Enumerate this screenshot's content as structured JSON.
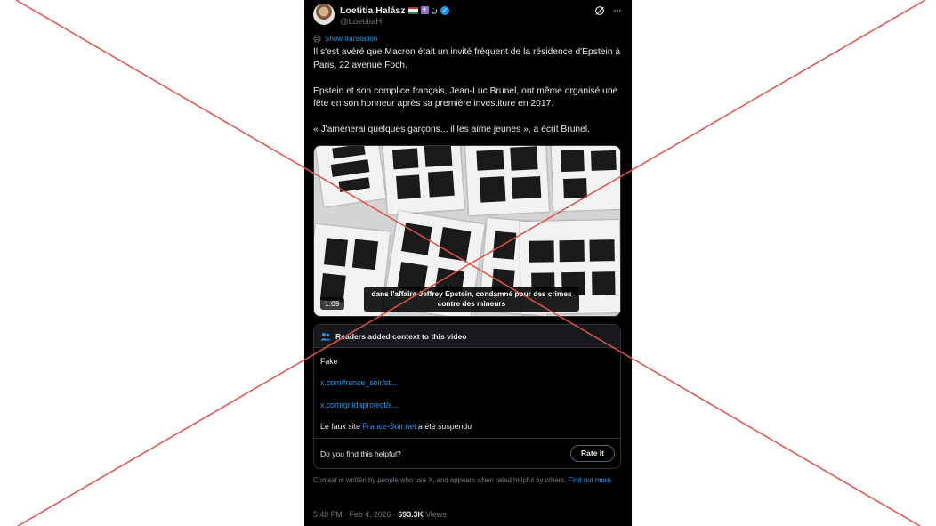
{
  "author": {
    "display_name": "Loetitia Halász",
    "arabic_glyph": "ن",
    "handle": "@LoetitiaH"
  },
  "icons": {
    "avatar": "avatar-photo",
    "flag": "hungarian-flag-icon",
    "religious": "latin-cross-icon",
    "verified": "verified-badge-icon",
    "grok": "grok-icon",
    "more": "more-icon",
    "translate": "globe-icon",
    "community": "people-icon"
  },
  "translate_label": "Show translation",
  "tweet": {
    "paragraph1": "Il s'est avéré que Macron était un invité fréquent de la résidence d'Epstein à Paris, 22 avenue Foch.",
    "paragraph2": "Epstein et son complice français, Jean-Luc Brunel, ont même organisé une fête en son honneur après sa première investiture en 2017.",
    "paragraph3": "« J'amènerai quelques garçons... il les aime jeunes », a écrit Brunel."
  },
  "video": {
    "duration": "1:09",
    "subtitle": "dans l'affaire Jeffrey Epstein, condamné pour des crimes contre des mineurs"
  },
  "community_note": {
    "title": "Readers added context to this video",
    "line1": "Fake",
    "link1": "x.com/france_soir/st...",
    "link2": "x.com/gnidaproject/s...",
    "line4_prefix": "Le faux site ",
    "line4_link": "France-Soir.net",
    "line4_suffix": " a été suspendu",
    "helpful_question": "Do you find this helpful?",
    "rate_button": "Rate it"
  },
  "context_footer": {
    "text": "Context is written by people who use X, and appears when rated helpful by others.",
    "link": "Find out more."
  },
  "meta": {
    "time": "5:48 PM",
    "separator": "·",
    "date": "Feb 4, 2026",
    "views_count": "693.3K",
    "views_label": "Views"
  },
  "colors": {
    "background": "#000000",
    "text": "#e7e9ea",
    "muted": "#71767b",
    "link": "#1d9bf0",
    "overlay_cross": "#e0514e"
  }
}
